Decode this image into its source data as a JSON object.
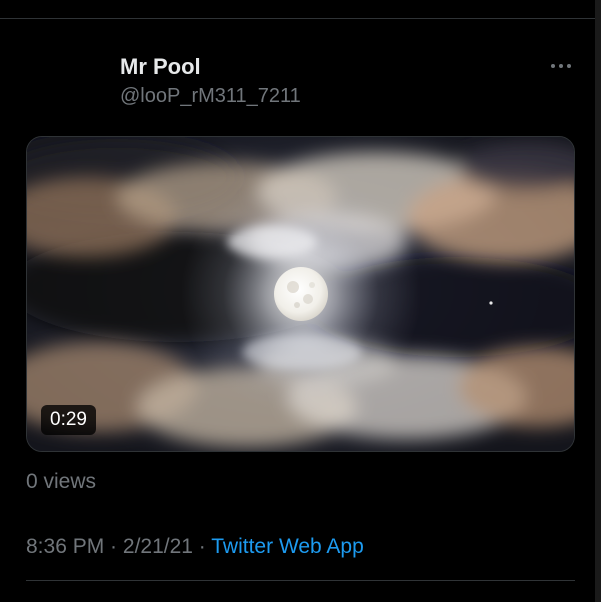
{
  "tweet": {
    "author": {
      "display_name": "Mr Pool",
      "handle": "@looP_rM311_7211"
    },
    "more_icon": "more-horizontal-icon",
    "media": {
      "type": "video",
      "subject": "full moon behind clouds at night",
      "duration": "0:29"
    },
    "views": "0 views",
    "timestamp": {
      "time": "8:36 PM",
      "separator1": " · ",
      "date": "2/21/21",
      "separator2": " · ",
      "source": "Twitter Web App"
    },
    "colors": {
      "background": "#000000",
      "primary_text": "#e7e9ea",
      "secondary_text": "#71767b",
      "link": "#1d9bf0",
      "divider": "#2f3336"
    }
  }
}
